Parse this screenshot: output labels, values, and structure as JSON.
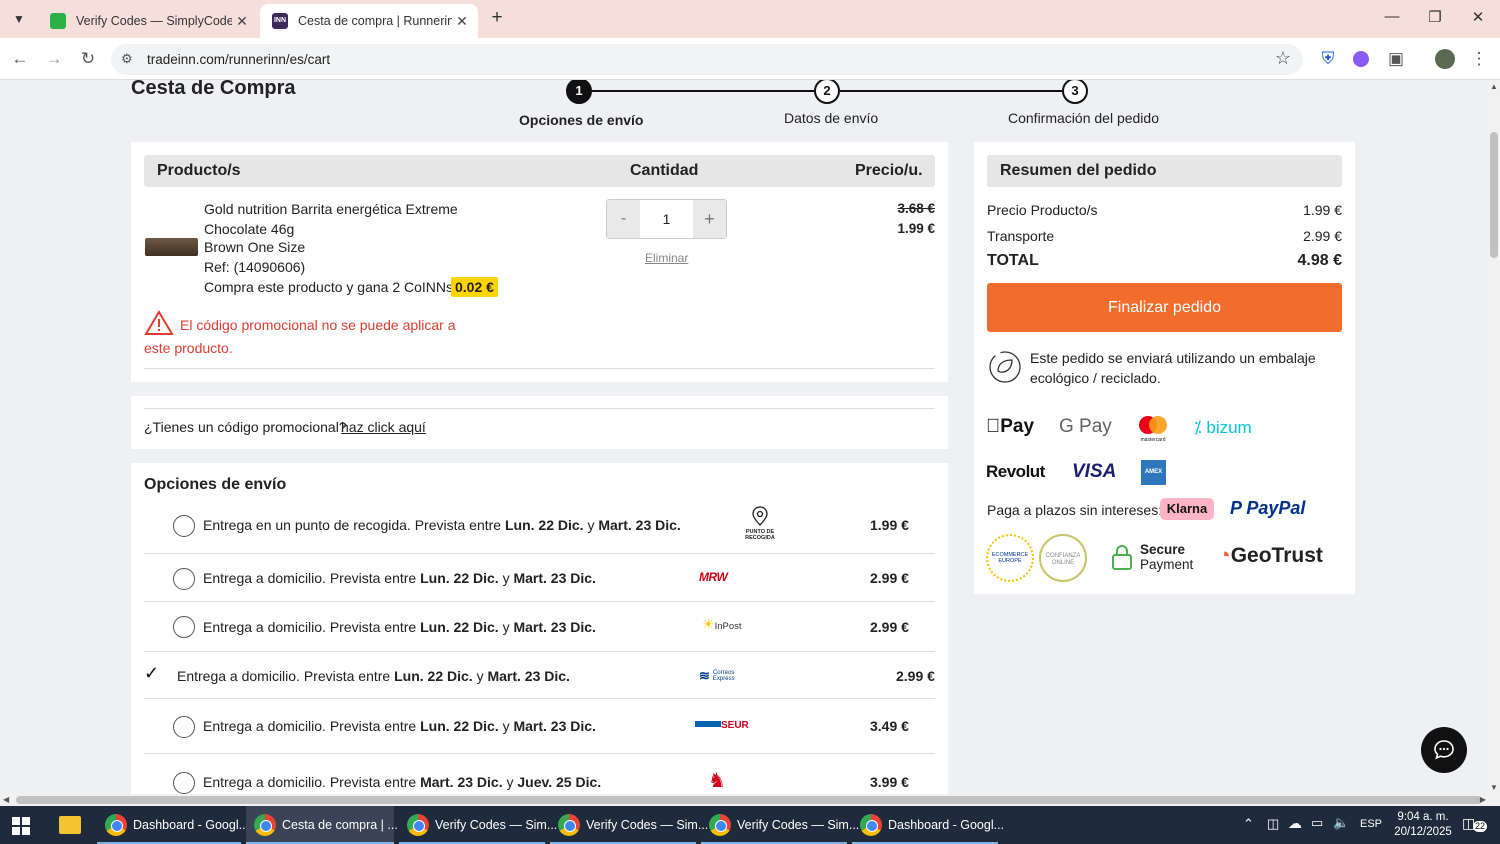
{
  "browser": {
    "tabs": [
      {
        "title": "Verify Codes — SimplyCodes",
        "active": false
      },
      {
        "title": "Cesta de compra | Runnerinn",
        "active": true
      }
    ],
    "url": "tradeinn.com/runnerinn/es/cart"
  },
  "page": {
    "title": "Cesta de Compra",
    "steps": [
      {
        "num": "1",
        "label": "Opciones de envío",
        "active": true
      },
      {
        "num": "2",
        "label": "Datos de envío",
        "active": false
      },
      {
        "num": "3",
        "label": "Confirmación del pedido",
        "active": false
      }
    ]
  },
  "cart": {
    "headers": {
      "product": "Producto/s",
      "quantity": "Cantidad",
      "price": "Precio/u."
    },
    "item": {
      "name": "Gold nutrition Barrita energética Extreme Chocolate 46g",
      "variant": "Brown One Size",
      "ref": "Ref: (14090606)",
      "coins_text": "Compra este producto y gana 2 CoINNs /",
      "coins_value": "0.02 €",
      "quantity": "1",
      "minus": "-",
      "plus": "+",
      "remove": "Eliminar",
      "old_price": "3.68 €",
      "price": "1.99 €"
    },
    "promo_error": "El código promocional no se puede aplicar a este producto.",
    "promo_question": "¿Tienes un código promocional?",
    "promo_link": "haz click aquí"
  },
  "shipping": {
    "title": "Opciones de envío",
    "options": [
      {
        "prefix": "Entrega en un punto de recogida. Prevista entre ",
        "d1": "Lun. 22 Dic.",
        "mid": " y ",
        "d2": "Mart. 23 Dic.",
        "carrier": "PUNTO DE RECOGIDA",
        "price": "1.99 €",
        "selected": false
      },
      {
        "prefix": "Entrega a domicilio. Prevista entre ",
        "d1": "Lun. 22 Dic.",
        "mid": " y ",
        "d2": "Mart. 23 Dic.",
        "carrier": "MRW",
        "price": "2.99 €",
        "selected": false
      },
      {
        "prefix": "Entrega a domicilio. Prevista entre ",
        "d1": "Lun. 22 Dic.",
        "mid": " y ",
        "d2": "Mart. 23 Dic.",
        "carrier": "InPost",
        "price": "2.99 €",
        "selected": false
      },
      {
        "prefix": "Entrega a domicilio. Prevista entre ",
        "d1": "Lun. 22 Dic.",
        "mid": " y ",
        "d2": "Mart. 23 Dic.",
        "carrier": "Correos Express",
        "price": "2.99 €",
        "selected": true
      },
      {
        "prefix": "Entrega a domicilio. Prevista entre ",
        "d1": "Lun. 22 Dic.",
        "mid": " y ",
        "d2": "Mart. 23 Dic.",
        "carrier": "SEUR",
        "price": "3.49 €",
        "selected": false
      },
      {
        "prefix": "Entrega a domicilio. Prevista entre ",
        "d1": "Mart. 23 Dic.",
        "mid": " y ",
        "d2": "Juev. 25 Dic.",
        "carrier": "Correos",
        "price": "3.99 €",
        "selected": false
      }
    ]
  },
  "summary": {
    "title": "Resumen del pedido",
    "rows": [
      {
        "label": "Precio Producto/s",
        "value": "1.99 €"
      },
      {
        "label": "Transporte",
        "value": "2.99 €"
      }
    ],
    "total_label": "TOTAL",
    "total_value": "4.98 €",
    "checkout": "Finalizar pedido",
    "eco_text": "Este pedido se enviará utilizando un embalaje ecológico / reciclado.",
    "payments": [
      "Pay",
      "G Pay",
      "mastercard",
      "bizum",
      "Revolut",
      "VISA",
      "AMEX"
    ],
    "installments_text": "Paga a plazos sin intereses:",
    "klarna": "Klarna",
    "paypal": "PayPal",
    "trust": {
      "ecommerce": "ECOMMERCE EUROPE",
      "confianza": "CONFIANZA ONLINE",
      "secure1": "Secure",
      "secure2": "Payment",
      "geotrust": "GeoTrust"
    }
  },
  "taskbar": {
    "items": [
      {
        "label": "Dashboard - Googl...",
        "active": false
      },
      {
        "label": "Cesta de compra | ...",
        "active": true
      },
      {
        "label": "Verify Codes — Sim...",
        "active": false
      },
      {
        "label": "Verify Codes — Sim...",
        "active": false
      },
      {
        "label": "Verify Codes — Sim...",
        "active": false
      },
      {
        "label": "Dashboard - Googl...",
        "active": false
      }
    ],
    "lang": "ESP",
    "time": "9:04 a. m.",
    "date": "20/12/2025",
    "notifications": "22"
  },
  "colors": {
    "accent": "#f26c2c",
    "error": "#e03c31",
    "coin": "#ffd500",
    "primary_text": "#222222"
  }
}
